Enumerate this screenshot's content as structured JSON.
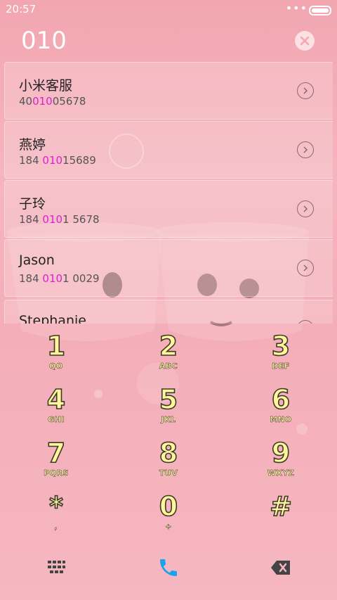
{
  "status": {
    "time": "20:57",
    "dots": "•••"
  },
  "dialer": {
    "input": "010"
  },
  "contacts": [
    {
      "name": "小米客服",
      "num_pre": "40",
      "num_hl": "010",
      "num_post": "05678"
    },
    {
      "name": "燕婷",
      "num_pre": "184 ",
      "num_hl": "010",
      "num_post": "15689"
    },
    {
      "name": "子玲",
      "num_pre": "184 ",
      "num_hl": "010",
      "num_post": "1 5678"
    },
    {
      "name": "Jason",
      "num_pre": "184 ",
      "num_hl": "010",
      "num_post": "1 0029"
    },
    {
      "name": "Stephanie",
      "num_pre": "",
      "num_hl": "",
      "num_post": ""
    }
  ],
  "keypad": [
    {
      "digit": "1",
      "letters": "QO"
    },
    {
      "digit": "2",
      "letters": "ABC"
    },
    {
      "digit": "3",
      "letters": "DEF"
    },
    {
      "digit": "4",
      "letters": "GHI"
    },
    {
      "digit": "5",
      "letters": "JKL"
    },
    {
      "digit": "6",
      "letters": "MNO"
    },
    {
      "digit": "7",
      "letters": "PQRS"
    },
    {
      "digit": "8",
      "letters": "TUV"
    },
    {
      "digit": "9",
      "letters": "WXYZ"
    },
    {
      "digit": "*",
      "letters": ","
    },
    {
      "digit": "0",
      "letters": "+"
    },
    {
      "digit": "#",
      "letters": ""
    }
  ],
  "colors": {
    "accent": "#1aa3ec",
    "highlight": "#e01fd0",
    "key_fill": "#fff59a"
  },
  "icons": {
    "keypad": "keypad-grid-icon",
    "call": "phone-icon",
    "delete": "backspace-icon"
  }
}
